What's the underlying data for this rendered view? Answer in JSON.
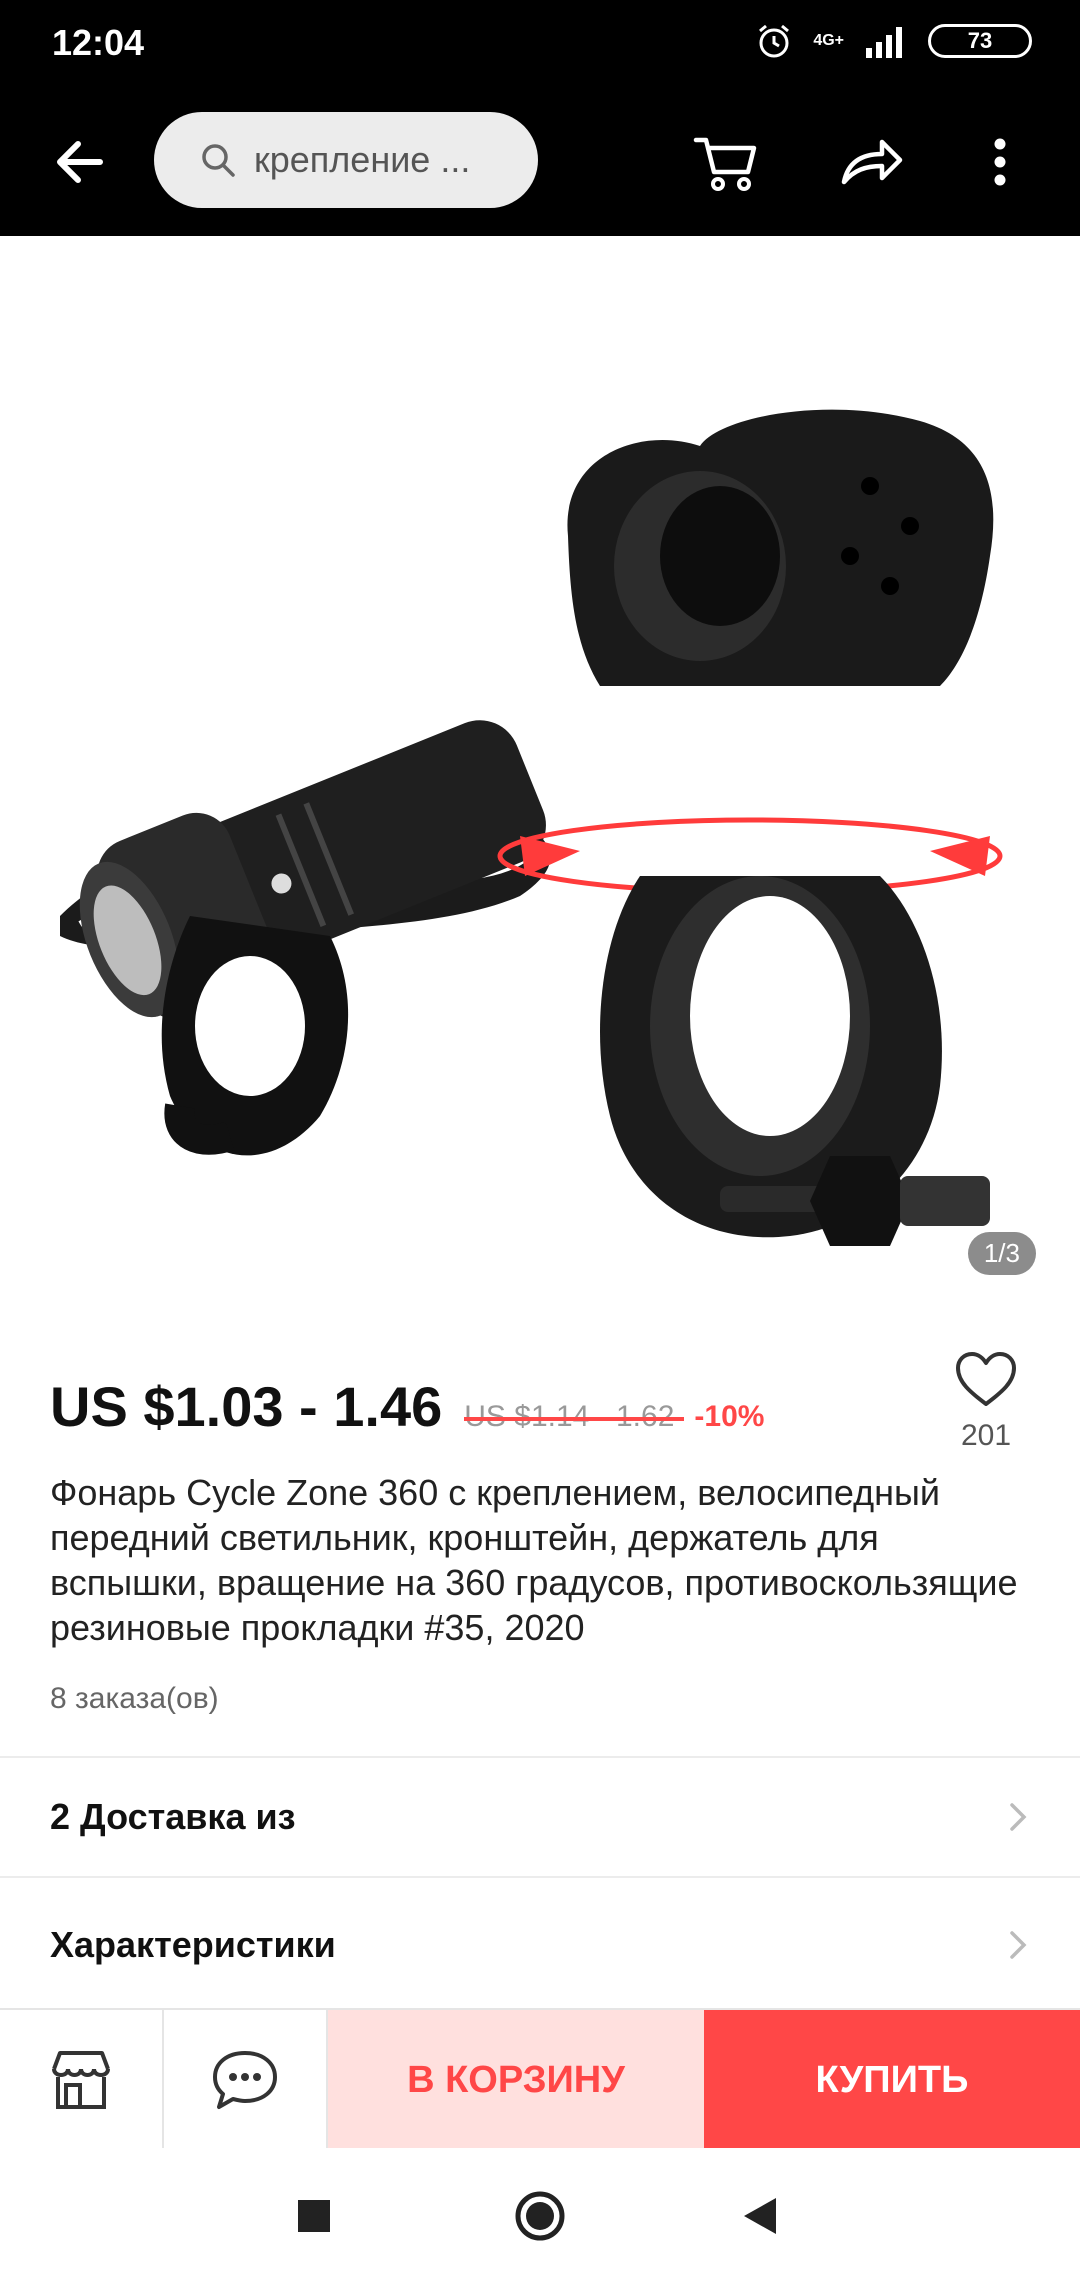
{
  "status_bar": {
    "time": "12:04",
    "network": "4G+",
    "battery": "73"
  },
  "toolbar": {
    "search_text": "крепление ..."
  },
  "product": {
    "image_counter": "1/3",
    "price": "US $1.03 - 1.46",
    "old_price": "US $1.14 - 1.62",
    "discount": "-10%",
    "favorites": "201",
    "title": "Фонарь Cycle Zone 360 с креплением, велосипедный передний светильник, кронштейн, держатель для вспышки, вращение на 360 градусов, противоскользящие резиновые прокладки #35, 2020",
    "orders": "8 заказа(ов)"
  },
  "rows": {
    "delivery": "2 Доставка из",
    "specs": "Характеристики"
  },
  "actions": {
    "add_to_cart": "В КОРЗИНУ",
    "buy": "КУПИТЬ"
  },
  "colors": {
    "accent": "#ff4747",
    "cart_bg": "#ffe0de"
  }
}
